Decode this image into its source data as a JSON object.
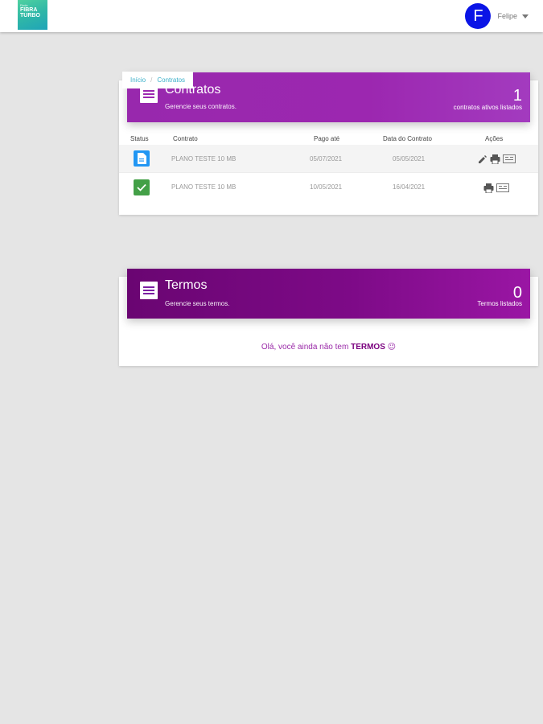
{
  "app": {
    "logo_small": "Rede",
    "logo_line1": "FIBRA",
    "logo_line2": "TURBO"
  },
  "user": {
    "initial": "F",
    "name": "Felipe"
  },
  "breadcrumb": {
    "items": [
      "Início",
      "Contratos"
    ],
    "separator": "/"
  },
  "contracts": {
    "title": "Contratos",
    "subtitle": "Gerencie seus contratos.",
    "count": "1",
    "count_label": "contratos ativos listados",
    "accent": "#9c27b0",
    "columns": [
      "Status",
      "Contrato",
      "Pago até",
      "Data do Contrato",
      "Ações"
    ],
    "rows": [
      {
        "status_icon": "document-icon",
        "status_color": "#2196f3",
        "contract": "PLANO TESTE 10 MB",
        "paid_until": "05/07/2021",
        "contract_date": "05/05/2021",
        "actions": [
          "edit-icon",
          "print-icon",
          "receipt-icon"
        ]
      },
      {
        "status_icon": "check-icon",
        "status_color": "#43a047",
        "contract": "PLANO TESTE 10 MB",
        "paid_until": "10/05/2021",
        "contract_date": "16/04/2021",
        "actions": [
          "print-icon",
          "receipt-icon"
        ]
      }
    ]
  },
  "terms": {
    "title": "Termos",
    "subtitle": "Gerencie seus termos.",
    "count": "0",
    "count_label": "Termos listados",
    "accent": "#7b1fa2",
    "empty_prefix": "Olá, você ainda não tem ",
    "empty_bold": "TERMOS",
    "empty_emoji": "😉"
  }
}
